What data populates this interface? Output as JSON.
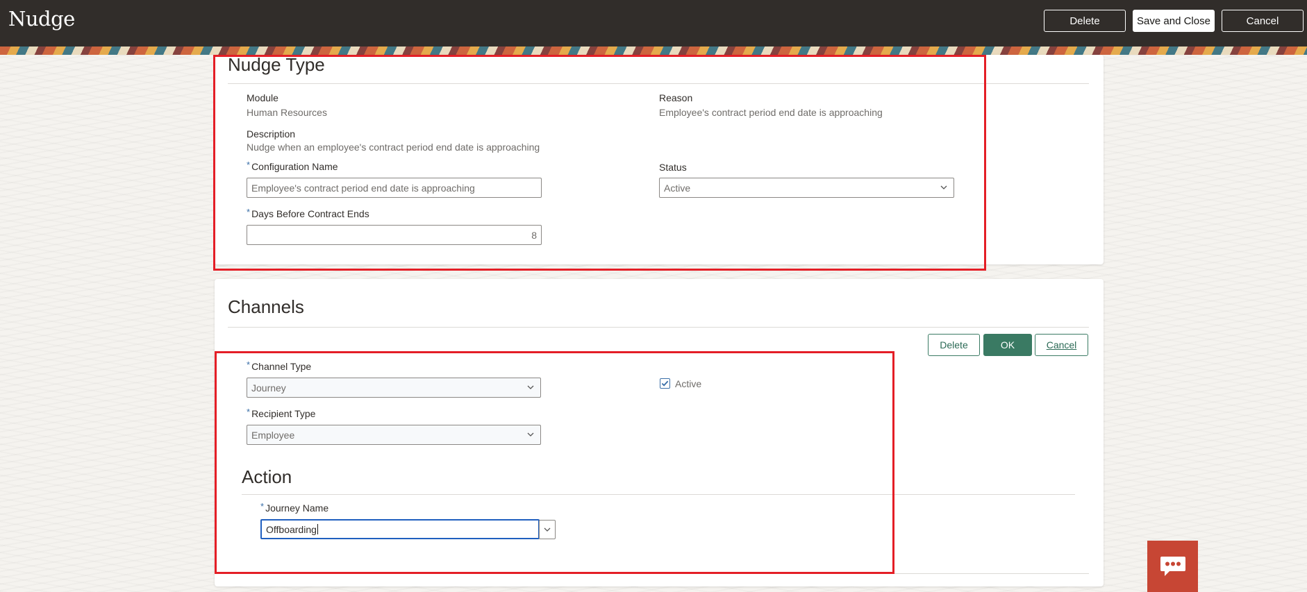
{
  "header": {
    "title": "Nudge",
    "delete_label": "Delete",
    "save_close_label": "Save and Close",
    "cancel_label": "Cancel"
  },
  "nudge_type": {
    "section_title": "Nudge Type",
    "module_label": "Module",
    "module_value": "Human Resources",
    "reason_label": "Reason",
    "reason_value": "Employee's contract period end date is approaching",
    "description_label": "Description",
    "description_value": "Nudge when an employee's contract period end date is approaching",
    "config_name_label": "Configuration Name",
    "config_name_value": "Employee's contract period end date is approaching",
    "status_label": "Status",
    "status_value": "Active",
    "days_label": "Days Before Contract Ends",
    "days_value": "8"
  },
  "channels": {
    "section_title": "Channels",
    "delete_label": "Delete",
    "ok_label": "OK",
    "cancel_label": "Cancel",
    "channel_type_label": "Channel Type",
    "channel_type_value": "Journey",
    "recipient_type_label": "Recipient Type",
    "recipient_type_value": "Employee",
    "active_label": "Active",
    "active_checked": true
  },
  "action": {
    "section_title": "Action",
    "journey_name_label": "Journey Name",
    "journey_name_value": "Offboarding"
  },
  "colors": {
    "header_bg": "#312d2a",
    "accent_green": "#3a7a63",
    "highlight_red": "#e41e26",
    "chat_bg": "#c74634"
  },
  "icons": {
    "chevron": "chevron-down-icon",
    "chat": "chat-bubble-icon",
    "check": "checkmark-icon"
  }
}
